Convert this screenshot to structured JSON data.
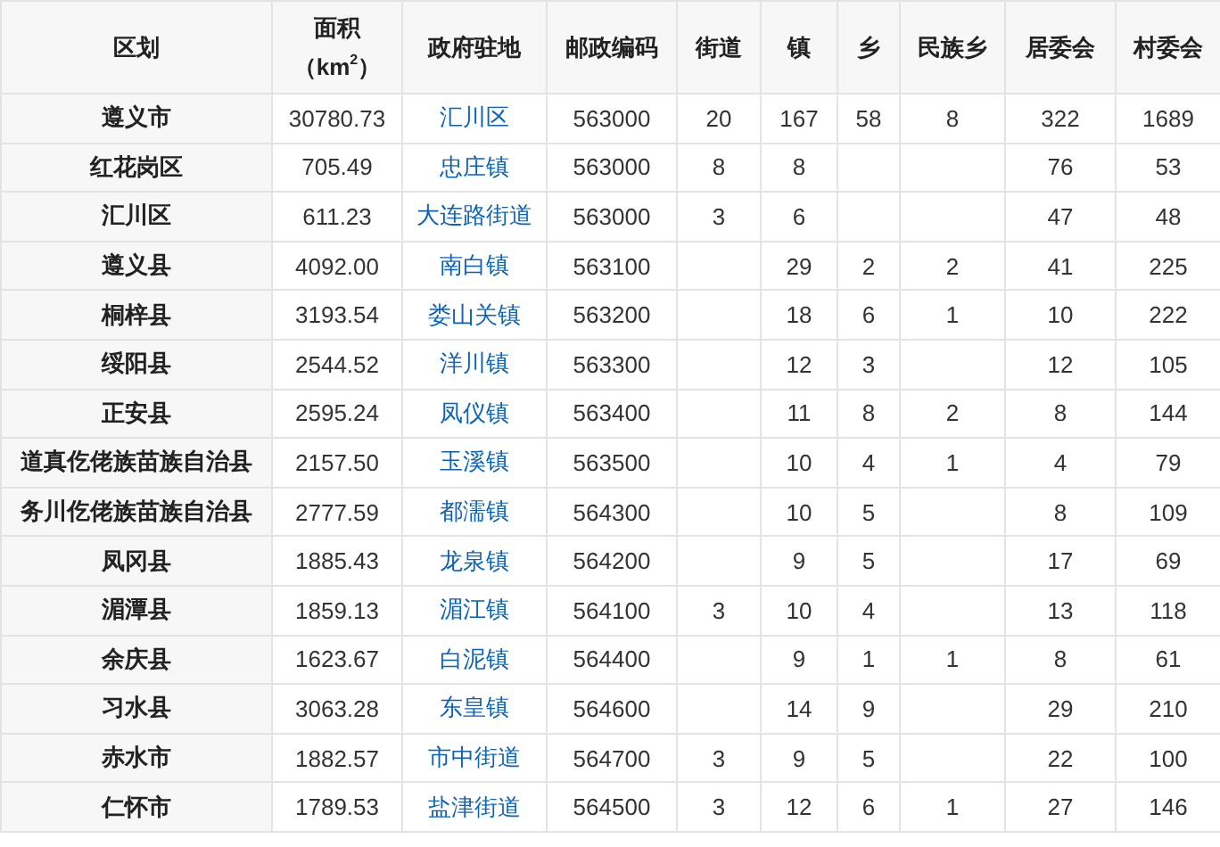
{
  "table": {
    "columns": [
      "区划",
      "面积",
      "政府驻地",
      "邮政编码",
      "街道",
      "镇",
      "乡",
      "民族乡",
      "居委会",
      "村委会"
    ],
    "area_unit": "（km$^{2}$）",
    "rows": [
      [
        "遵义市",
        "30780.73",
        "汇川区",
        "563000",
        "20",
        "167",
        "58",
        "8",
        "322",
        "1689"
      ],
      [
        "红花岗区",
        "705.49",
        "忠庄镇",
        "563000",
        "8",
        "8",
        null,
        null,
        "76",
        "53"
      ],
      [
        "汇川区",
        "611.23",
        "大连路街道",
        "563000",
        "3",
        "6",
        null,
        null,
        "47",
        "48"
      ],
      [
        "遵义县",
        "4092.00",
        "南白镇",
        "563100",
        null,
        "29",
        "2",
        "2",
        "41",
        "225"
      ],
      [
        "桐梓县",
        "3193.54",
        "娄山关镇",
        "563200",
        null,
        "18",
        "6",
        "1",
        "10",
        "222"
      ],
      [
        "绥阳县",
        "2544.52",
        "洋川镇",
        "563300",
        null,
        "12",
        "3",
        null,
        "12",
        "105"
      ],
      [
        "正安县",
        "2595.24",
        "凤仪镇",
        "563400",
        null,
        "11",
        "8",
        "2",
        "8",
        "144"
      ],
      [
        "道真仡佬族苗族自治县",
        "2157.50",
        "玉溪镇",
        "563500",
        null,
        "10",
        "4",
        "1",
        "4",
        "79"
      ],
      [
        "务川仡佬族苗族自治县",
        "2777.59",
        "都濡镇",
        "564300",
        null,
        "10",
        "5",
        null,
        "8",
        "109"
      ],
      [
        "凤冈县",
        "1885.43",
        "龙泉镇",
        "564200",
        null,
        "9",
        "5",
        null,
        "17",
        "69"
      ],
      [
        "湄潭县",
        "1859.13",
        "湄江镇",
        "564100",
        "3",
        "10",
        "4",
        null,
        "13",
        "118"
      ],
      [
        "余庆县",
        "1623.67",
        "白泥镇",
        "564400",
        null,
        "9",
        "1",
        "1",
        "8",
        "61"
      ],
      [
        "习水县",
        "3063.28",
        "东皇镇",
        "564600",
        null,
        "14",
        "9",
        null,
        "29",
        "210"
      ],
      [
        "赤水市",
        "1882.57",
        "市中街道",
        "564700",
        "3",
        "9",
        "5",
        null,
        "22",
        "100"
      ],
      [
        "仁怀市",
        "1789.53",
        "盐津街道",
        "564500",
        "3",
        "12",
        "6",
        "1",
        "27",
        "146"
      ]
    ]
  }
}
